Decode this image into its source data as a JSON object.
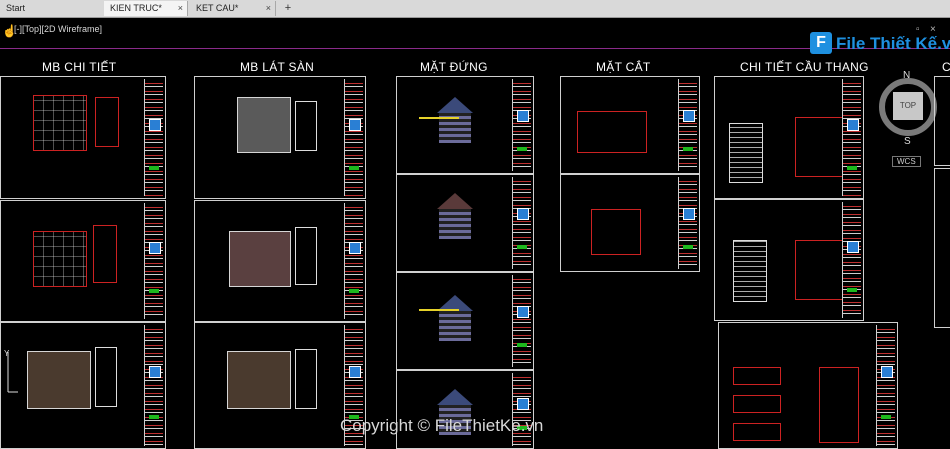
{
  "tabs": [
    {
      "label": "Start",
      "active": false,
      "closable": false
    },
    {
      "label": "KIEN TRUC*",
      "active": true,
      "closable": true
    },
    {
      "label": "KET CAU*",
      "active": false,
      "closable": true
    }
  ],
  "new_tab_label": "+",
  "viewport": {
    "label": "[-][Top][2D Wireframe]",
    "controls": [
      "–",
      "▫",
      "×"
    ]
  },
  "sheet_titles": [
    "MB CHI TIẾT",
    "MB LÁT SÀN",
    "MẶT ĐỨNG",
    "MẶT CẮT",
    "CHI TIẾT CẦU THANG",
    "C"
  ],
  "logo": {
    "mark": "F",
    "text": "File Thiết Kế.vn"
  },
  "viewcube": {
    "north": "N",
    "south": "S",
    "face": "TOP",
    "wcs": "WCS"
  },
  "watermark": "Copyright © FileThietKe.vn",
  "colors": {
    "canvas": "#000000",
    "tabbar": "#d9d9d9",
    "accent": "#1e90e0",
    "sheet_border": "#d0d0d0",
    "magenta_line": "#8a2b8a"
  }
}
